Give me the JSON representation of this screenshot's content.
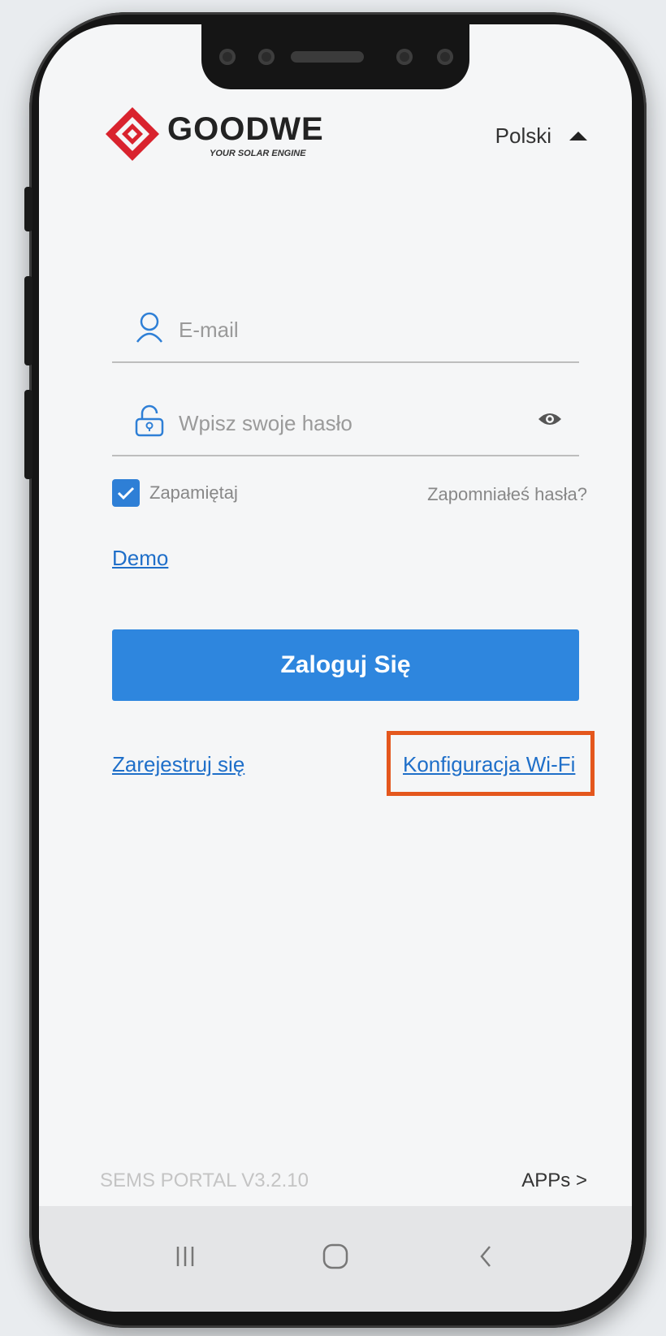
{
  "language": {
    "label": "Polski",
    "arrow_icon": "caret-up-icon"
  },
  "brand": {
    "name": "GOODWE",
    "tagline": "YOUR SOLAR ENGINE",
    "color": "#d9232e"
  },
  "form": {
    "email_placeholder": "E-mail",
    "password_placeholder": "Wpisz swoje hasło",
    "remember_label": "Zapamiętaj",
    "remember_checked": true,
    "forgot_label": "Zapomniałeś hasła?",
    "demo_label": "Demo",
    "login_label": "Zaloguj Się",
    "register_label": "Zarejestruj się",
    "wifi_label": "Konfiguracja Wi-Fi"
  },
  "footer": {
    "portal_label": "SEMS PORTAL  V3.2.10",
    "apps_label": "APPs  >"
  },
  "colors": {
    "accent": "#2e86de",
    "link": "#1f6fc9",
    "highlight": "#e4571d"
  }
}
